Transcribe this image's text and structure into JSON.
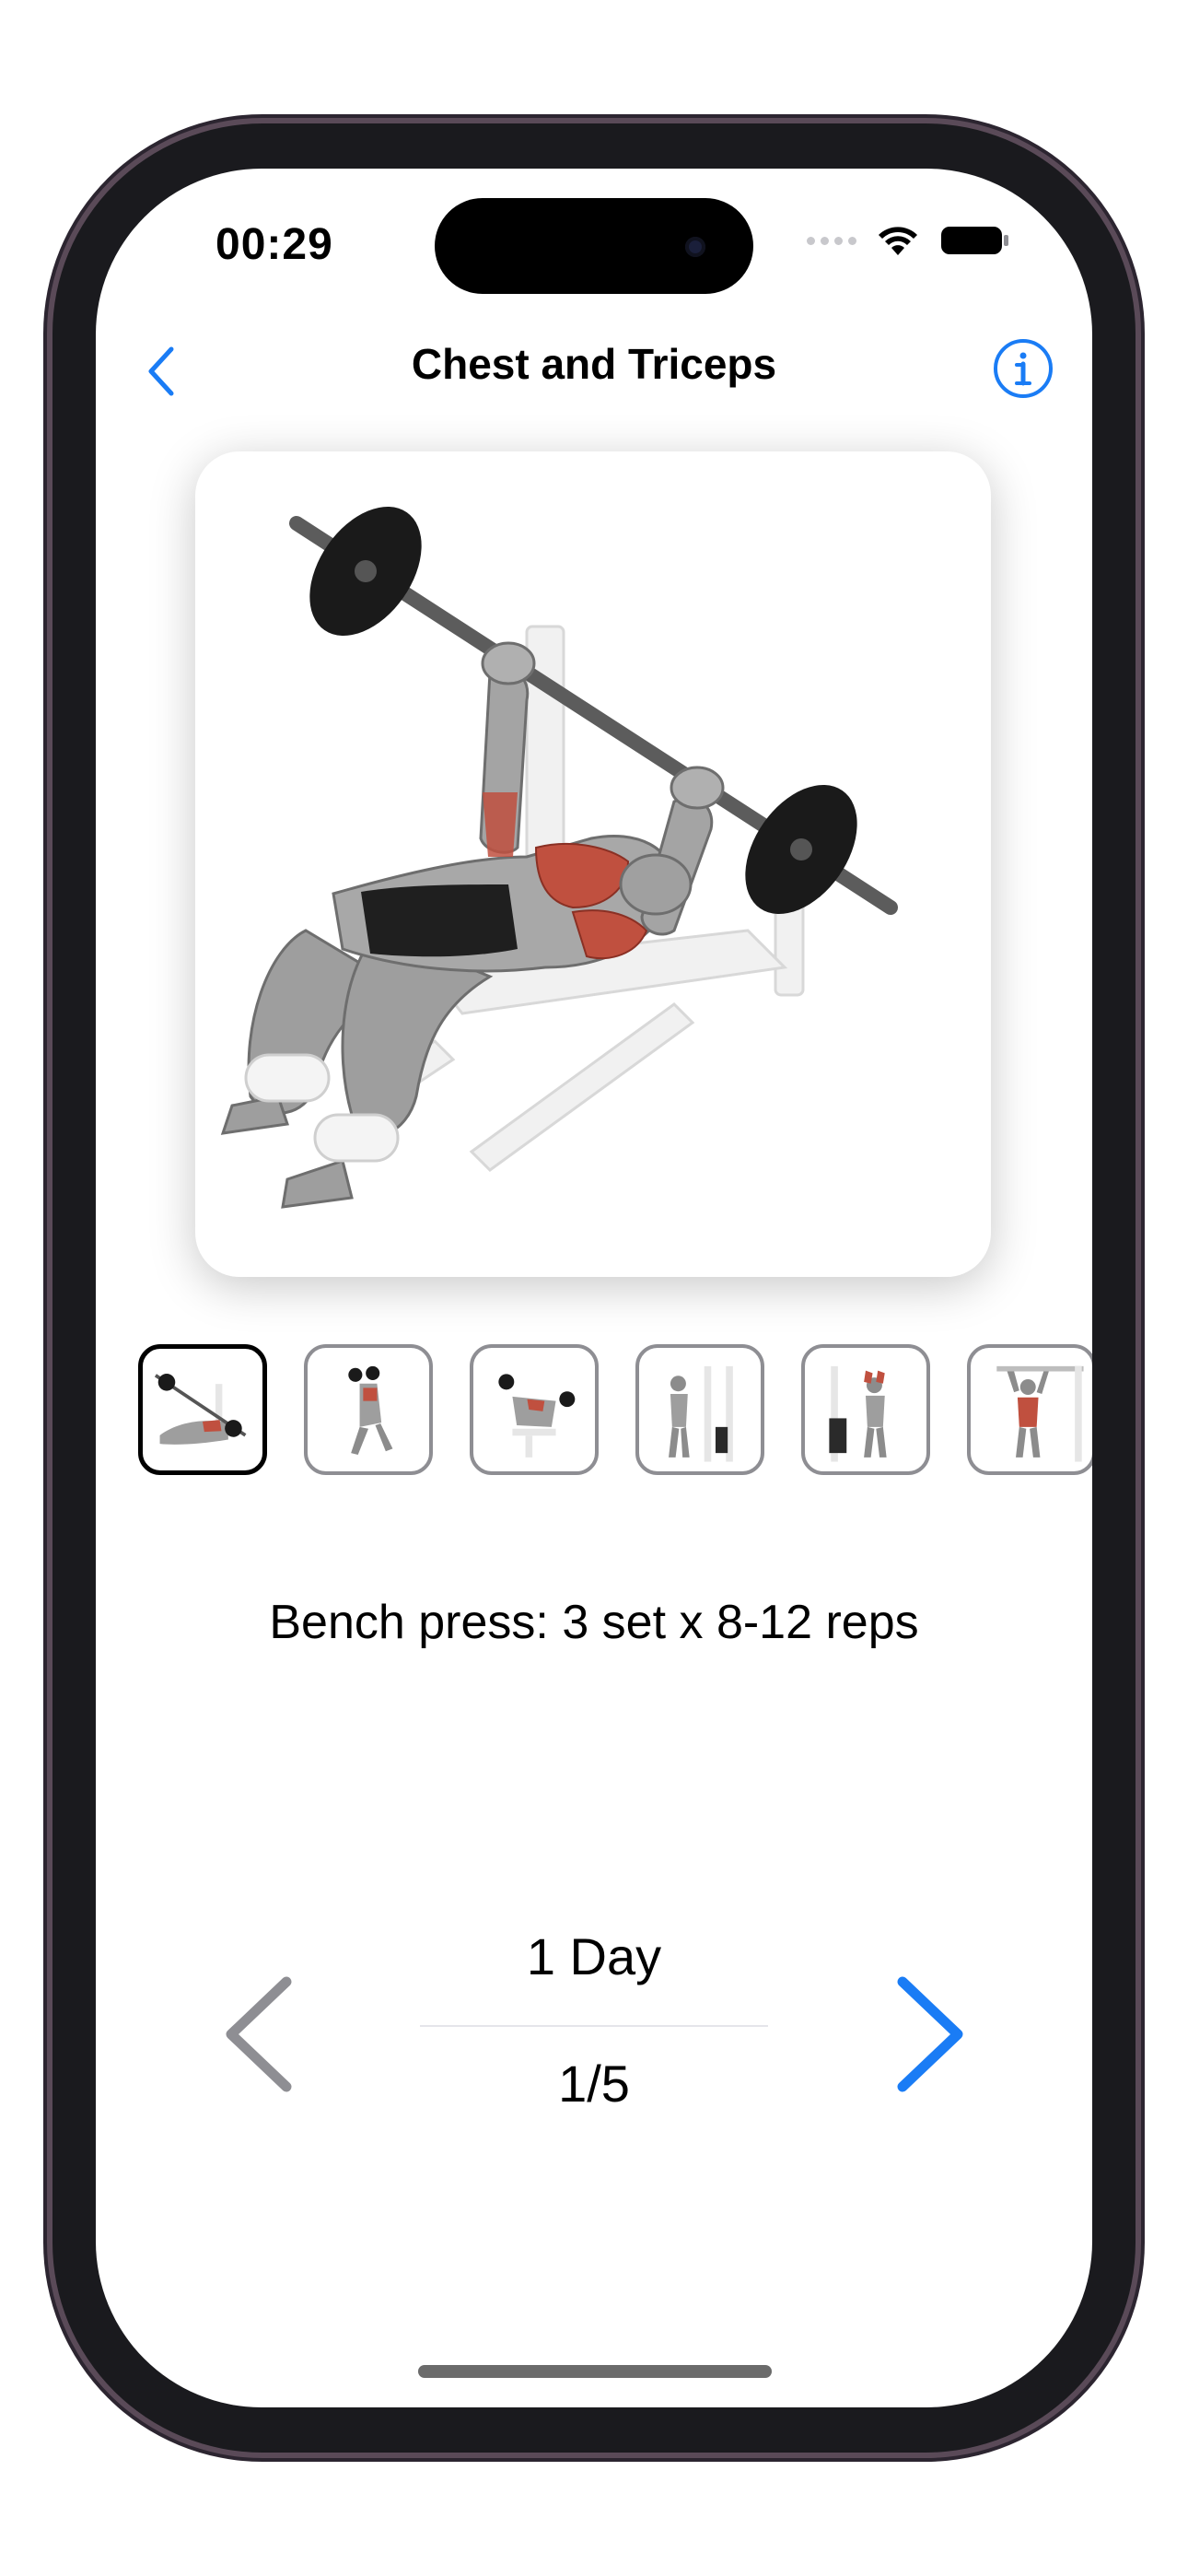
{
  "status_bar": {
    "time": "00:29",
    "icons": [
      "signal-icon",
      "wifi-icon",
      "battery-icon"
    ]
  },
  "nav": {
    "back_icon": "chevron-left-icon",
    "title": "Chest and Triceps",
    "info_icon": "info-circle-icon"
  },
  "hero": {
    "illustration": "bench-press-illustration"
  },
  "thumbnails": [
    {
      "icon": "bench-press-thumb",
      "selected": true
    },
    {
      "icon": "incline-dumbbell-press-thumb",
      "selected": false
    },
    {
      "icon": "dumbbell-fly-thumb",
      "selected": false
    },
    {
      "icon": "cable-pushdown-thumb",
      "selected": false
    },
    {
      "icon": "overhead-extension-thumb",
      "selected": false
    },
    {
      "icon": "pull-up-thumb",
      "selected": false
    }
  ],
  "exercise": {
    "text": "Bench press: 3 set x 8-12 reps"
  },
  "day_nav": {
    "day_label": "1 Day",
    "counter": "1/5",
    "prev_icon": "chevron-left-icon",
    "next_icon": "chevron-right-icon"
  },
  "colors": {
    "accent": "#1a7cf5",
    "disabled": "#8e8e93",
    "muscle": "#c0503f"
  }
}
